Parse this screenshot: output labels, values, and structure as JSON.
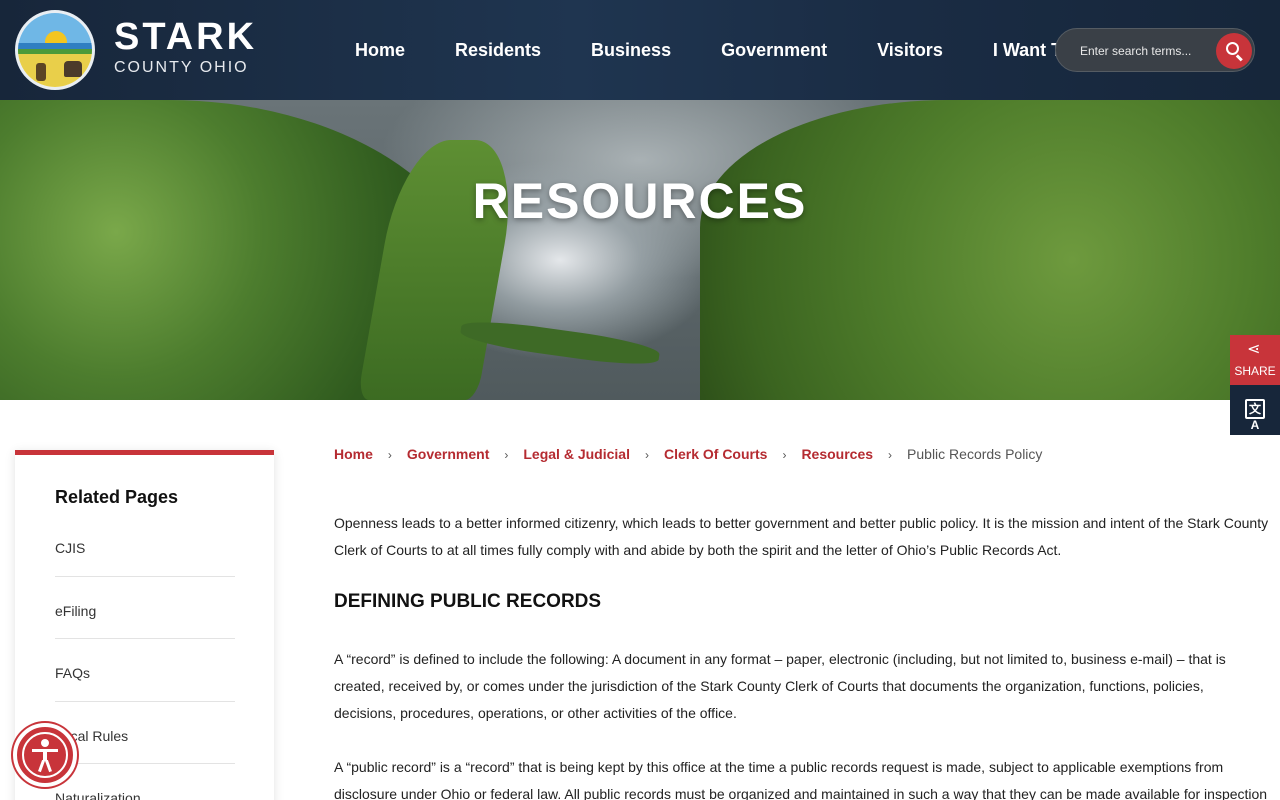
{
  "header": {
    "brand_name": "STARK",
    "brand_sub": "COUNTY OHIO",
    "nav": [
      "Home",
      "Residents",
      "Business",
      "Government",
      "Visitors",
      "I Want To"
    ],
    "search_placeholder": "Enter search terms..."
  },
  "hero": {
    "title": "RESOURCES"
  },
  "widgets": {
    "share_label": "SHARE",
    "translate_glyph": "文A"
  },
  "sidebar": {
    "heading": "Related Pages",
    "items": [
      "CJIS",
      "eFiling",
      "FAQs",
      "Local Rules",
      "Naturalization"
    ]
  },
  "breadcrumb": {
    "links": [
      "Home",
      "Government",
      "Legal & Judicial",
      "Clerk Of Courts",
      "Resources"
    ],
    "current": "Public Records Policy",
    "separator": "›"
  },
  "content": {
    "intro": "Openness leads to a better informed citizenry, which leads to better government and better public policy. It is the mission and intent of the Stark County Clerk of Courts to at all times fully comply with and abide by both the spirit and the letter of Ohio’s Public Records Act.",
    "section_heading": "DEFINING PUBLIC RECORDS",
    "record_def": "A “record” is defined to include the following: A document in any format – paper, electronic (including, but not limited to, business e-mail) – that is created, received by, or comes under the jurisdiction of the  Stark County Clerk of Courts that documents the organization, functions, policies, decisions, procedures, operations, or other activities of the office.",
    "public_record_def": "A “public record” is a “record” that is being kept by this office at the time a public records request is made, subject to applicable exemptions from disclosure under Ohio or federal law. All public records must be organized and maintained in such a way that they can be made available for inspection"
  },
  "colors": {
    "accent": "#c8343a",
    "header_bg": "#17263a",
    "link": "#b52b31"
  }
}
